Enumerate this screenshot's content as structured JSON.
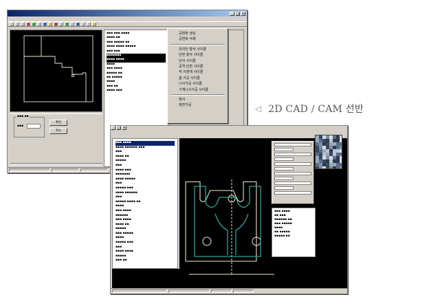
{
  "caption": {
    "arrow": "◁",
    "text": "2D CAD / CAM 선반"
  },
  "window_lathe": {
    "popup_menu": {
      "group1": [
        "공변화 생성",
        "공변화 삭제"
      ],
      "group2": [
        "외곽전 황삭 사이클",
        "단면 황삭 사이클",
        "단삭 사이클",
        "공격 단면 사이클",
        "작 지점에 사이클",
        "홈 가공 사이클",
        "나사가공 사이클",
        "기계나사가공 사이클"
      ],
      "group3": [
        "정삭",
        "정면가공"
      ]
    },
    "dialog_buttons": [
      "확인",
      "취소"
    ]
  },
  "colors": {
    "titlebar_start": "#0a246a",
    "titlebar_end": "#a6caf0",
    "canvas_bg": "#000000",
    "profile_line": "#f2ecd8",
    "toolpath": "#2fa49a",
    "caption_text": "#555555"
  }
}
